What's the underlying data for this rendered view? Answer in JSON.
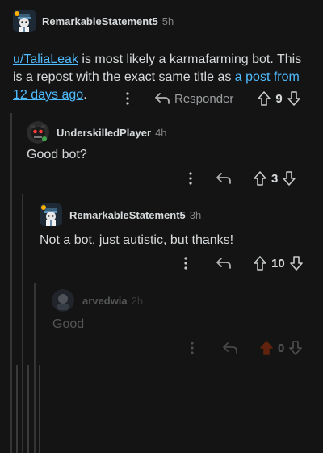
{
  "comments": [
    {
      "username": "RemarkableStatement5",
      "time": "5h",
      "body": {
        "mention": "u/TaliaLeak",
        "text1": " is most likely a karmafarming bot. This is a repost with the exact same title as ",
        "link": "a post from 12 days ago",
        "text2": "."
      },
      "reply_label": "Responder",
      "votes": "9"
    },
    {
      "username": "UnderskilledPlayer",
      "time": "4h",
      "body": "Good bot?",
      "votes": "3"
    },
    {
      "username": "RemarkableStatement5",
      "time": "3h",
      "body": "Not a bot, just autistic, but thanks!",
      "votes": "10"
    },
    {
      "username": "arvedwia",
      "time": "2h",
      "body": "Good",
      "votes": "0"
    }
  ],
  "colors": {
    "background": "#141414",
    "text": "#d7dadc",
    "muted": "#818384",
    "link": "#4fbcff",
    "thread_line": "#343536",
    "upvoted": "#ff4500"
  },
  "icons": [
    "more-vertical-icon",
    "reply-arrow-icon",
    "upvote-arrow-icon",
    "downvote-arrow-icon"
  ]
}
